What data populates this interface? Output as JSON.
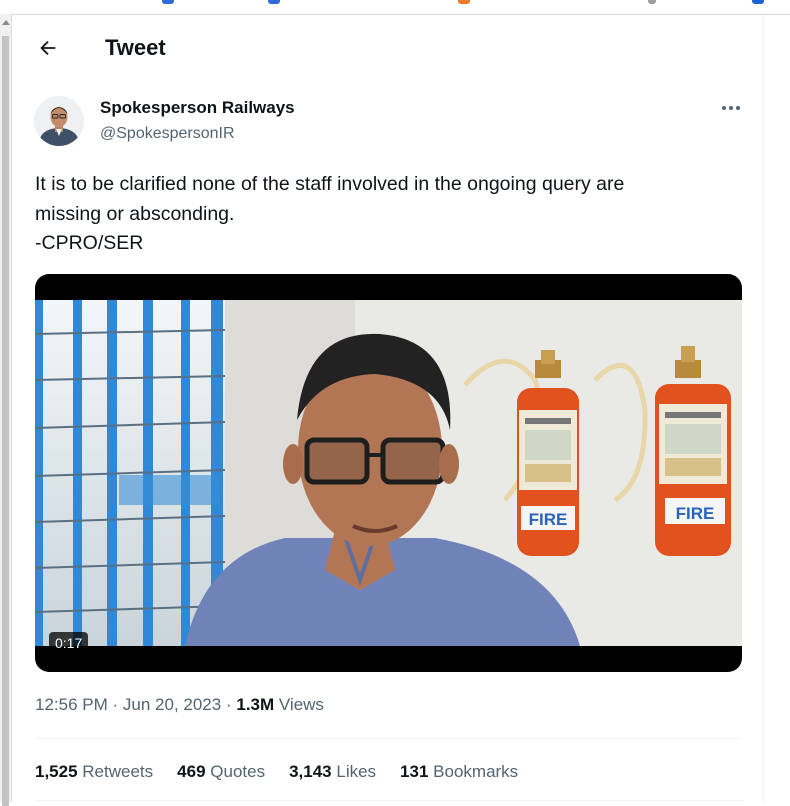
{
  "header": {
    "title": "Tweet",
    "back_icon": "arrow-left-icon"
  },
  "author": {
    "name": "Spokesperson Railways",
    "handle": "@SpokespersonIR",
    "more_icon": "more-horizontal-icon"
  },
  "tweet": {
    "lines": [
      "It is to be clarified none of the staff involved in the ongoing query are",
      "missing or absconding.",
      "-CPRO/SER"
    ]
  },
  "media": {
    "duration": "0:17",
    "fire_label": "FIRE"
  },
  "meta": {
    "time": "12:56 PM",
    "separator": "·",
    "date": "Jun 20, 2023",
    "views_count": "1.3M",
    "views_label": "Views"
  },
  "stats": [
    {
      "count": "1,525",
      "label": "Retweets"
    },
    {
      "count": "469",
      "label": "Quotes"
    },
    {
      "count": "3,143",
      "label": "Likes"
    },
    {
      "count": "131",
      "label": "Bookmarks"
    }
  ],
  "colors": {
    "text": "#0f1419",
    "secondary": "#536471",
    "divider": "#eff3f4",
    "extinguisher": "#e1521f"
  }
}
